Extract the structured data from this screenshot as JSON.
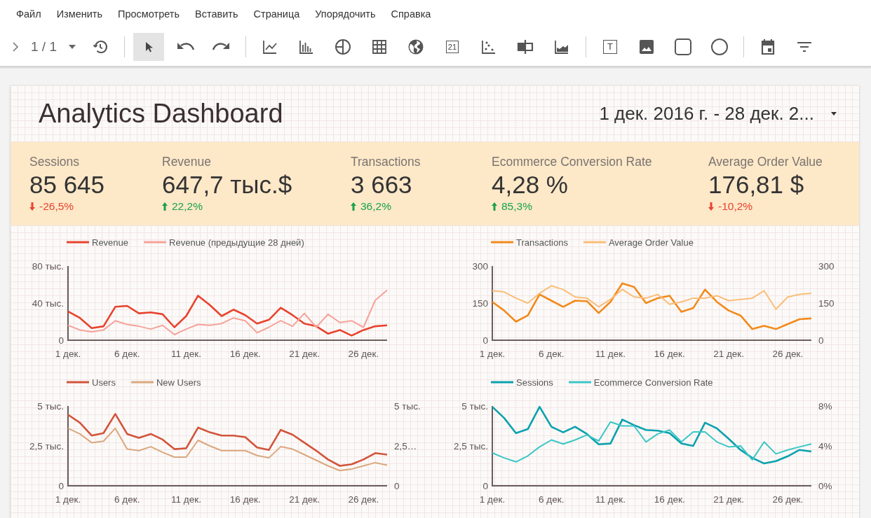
{
  "menu": [
    "Файл",
    "Изменить",
    "Просмотреть",
    "Вставить",
    "Страница",
    "Упорядочить",
    "Справка"
  ],
  "toolbar": {
    "groups": [
      [
        {
          "kind": "next-page",
          "selected": false
        },
        {
          "kind": "page",
          "label": "1 / 1",
          "selected": false
        },
        {
          "kind": "dropdown",
          "selected": false
        },
        {
          "kind": "history",
          "selected": false
        }
      ],
      [
        {
          "kind": "pointer",
          "selected": true
        },
        {
          "kind": "undo",
          "selected": false
        },
        {
          "kind": "redo",
          "selected": false
        }
      ],
      [
        {
          "kind": "line-chart",
          "selected": false
        },
        {
          "kind": "bar-chart",
          "selected": false
        },
        {
          "kind": "pie-chart",
          "selected": false
        },
        {
          "kind": "table",
          "selected": false
        },
        {
          "kind": "geo-map",
          "selected": false
        },
        {
          "kind": "scorecard",
          "label": "21",
          "selected": false
        },
        {
          "kind": "scatter",
          "selected": false
        },
        {
          "kind": "bullet",
          "selected": false
        },
        {
          "kind": "area-chart",
          "selected": false
        }
      ],
      [
        {
          "kind": "text",
          "label": "T",
          "selected": false
        },
        {
          "kind": "image",
          "selected": false
        },
        {
          "kind": "rectangle",
          "selected": false
        },
        {
          "kind": "circle",
          "selected": false
        }
      ],
      [
        {
          "kind": "calendar",
          "selected": false
        },
        {
          "kind": "filter",
          "selected": false
        }
      ]
    ]
  },
  "report": {
    "title": "Analytics Dashboard",
    "date_range": "1 дек. 2016 г. - 28 дек. 2...",
    "scorecards": [
      {
        "label": "Sessions",
        "value": "85 645",
        "delta": "-26,5%",
        "increase": false
      },
      {
        "label": "Revenue",
        "value": "647,7 тыс.$",
        "delta": "22,2%",
        "increase": true
      },
      {
        "label": "Transactions",
        "value": "3 663",
        "delta": "36,2%",
        "increase": true
      },
      {
        "label": "Ecommerce Conversion Rate",
        "value": "4,28 %",
        "delta": "85,3%",
        "increase": true
      },
      {
        "label": "Average Order Value",
        "value": "176,81 $",
        "delta": "-10,2%",
        "increase": false
      }
    ],
    "charts": [
      {
        "chart_data": {
          "type": "line",
          "x": [
            1,
            2,
            3,
            4,
            5,
            6,
            7,
            8,
            9,
            10,
            11,
            12,
            13,
            14,
            15,
            16,
            17,
            18,
            19,
            20,
            21,
            22,
            23,
            24,
            25,
            26,
            27,
            28
          ],
          "legend": true,
          "xlim": [
            1,
            28
          ],
          "ylim": [
            0,
            80
          ],
          "yticks": [
            {
              "value": 0,
              "label": "0"
            },
            {
              "value": 40,
              "label": "40 тыс."
            },
            {
              "value": 80,
              "label": "80 тыс."
            }
          ],
          "xticks": [
            {
              "value": 1,
              "label": "1 дек."
            },
            {
              "value": 6,
              "label": "6 дек."
            },
            {
              "value": 11,
              "label": "11 дек."
            },
            {
              "value": 16,
              "label": "16 дек."
            },
            {
              "value": 21,
              "label": "21 дек."
            },
            {
              "value": 26,
              "label": "26 дек."
            }
          ],
          "series": [
            {
              "name": "Revenue",
              "color": "#e8432e",
              "values": [
                31,
                24,
                13,
                15,
                36,
                37,
                29,
                30,
                28,
                14,
                26,
                48,
                38,
                26,
                33,
                27,
                18,
                22,
                35,
                27,
                18,
                15,
                7,
                11,
                5,
                11,
                15,
                16
              ]
            },
            {
              "name": "Revenue (предыдущие 28 дней)",
              "color": "#f6a29a",
              "values": [
                16,
                11,
                9,
                11,
                21,
                17,
                15,
                12,
                16,
                6,
                12,
                17,
                16,
                18,
                24,
                21,
                8,
                14,
                21,
                15,
                29,
                14,
                28,
                19,
                21,
                14,
                43,
                54
              ]
            }
          ]
        }
      },
      {
        "chart_data": {
          "type": "line",
          "x": [
            1,
            2,
            3,
            4,
            5,
            6,
            7,
            8,
            9,
            10,
            11,
            12,
            13,
            14,
            15,
            16,
            17,
            18,
            19,
            20,
            21,
            22,
            23,
            24,
            25,
            26,
            27,
            28
          ],
          "legend": true,
          "xlim": [
            1,
            28
          ],
          "ylim": [
            0,
            300
          ],
          "yticks": [
            0,
            150,
            300
          ],
          "y2lim": [
            0,
            300
          ],
          "y2ticks": [
            0,
            150,
            300
          ],
          "xticks": [
            {
              "value": 1,
              "label": "1 дек."
            },
            {
              "value": 6,
              "label": "6 дек."
            },
            {
              "value": 11,
              "label": "11 дек."
            },
            {
              "value": 16,
              "label": "16 дек."
            },
            {
              "value": 21,
              "label": "21 дек."
            },
            {
              "value": 26,
              "label": "26 дек."
            }
          ],
          "series": [
            {
              "name": "Transactions",
              "color": "#f28a1c",
              "values": [
                155,
                120,
                75,
                100,
                185,
                160,
                135,
                160,
                158,
                110,
                155,
                230,
                215,
                150,
                170,
                180,
                115,
                130,
                205,
                155,
                120,
                100,
                45,
                58,
                45,
                65,
                85,
                88
              ]
            },
            {
              "name": "Average Order Value",
              "color": "#fbbd78",
              "axis": "y2",
              "values": [
                200,
                195,
                170,
                150,
                190,
                220,
                205,
                175,
                170,
                135,
                165,
                205,
                175,
                170,
                185,
                145,
                155,
                170,
                170,
                180,
                160,
                165,
                170,
                200,
                125,
                175,
                185,
                190
              ]
            }
          ]
        }
      },
      {
        "chart_data": {
          "type": "line",
          "x": [
            1,
            2,
            3,
            4,
            5,
            6,
            7,
            8,
            9,
            10,
            11,
            12,
            13,
            14,
            15,
            16,
            17,
            18,
            19,
            20,
            21,
            22,
            23,
            24,
            25,
            26,
            27,
            28
          ],
          "legend": true,
          "xlim": [
            1,
            28
          ],
          "ylim": [
            0,
            5
          ],
          "yticks": [
            {
              "value": 0,
              "label": "0"
            },
            {
              "value": 2.5,
              "label": "2,5 тыс."
            },
            {
              "value": 5,
              "label": "5 тыс."
            }
          ],
          "y2lim": [
            0,
            5
          ],
          "y2ticks": [
            {
              "value": 0,
              "label": "0"
            },
            {
              "value": 2.5,
              "label": "2,5…"
            },
            {
              "value": 5,
              "label": "5 тыс."
            }
          ],
          "xticks": [
            {
              "value": 1,
              "label": "1 дек."
            },
            {
              "value": 6,
              "label": "6 дек."
            },
            {
              "value": 11,
              "label": "11 дек."
            },
            {
              "value": 16,
              "label": "16 дек."
            },
            {
              "value": 21,
              "label": "21 дек."
            },
            {
              "value": 26,
              "label": "26 дек."
            }
          ],
          "series": [
            {
              "name": "Users",
              "color": "#d2543a",
              "values": [
                4.45,
                3.95,
                3.15,
                3.3,
                4.5,
                3.25,
                3.0,
                3.25,
                2.9,
                2.3,
                2.35,
                3.65,
                3.35,
                3.15,
                3.15,
                3.05,
                2.4,
                2.25,
                3.5,
                3.2,
                2.7,
                2.2,
                1.65,
                1.25,
                1.35,
                1.65,
                2.05,
                1.95
              ]
            },
            {
              "name": "New Users",
              "color": "#dba77e",
              "axis": "y2",
              "values": [
                3.6,
                3.25,
                2.7,
                2.8,
                3.6,
                2.3,
                2.2,
                2.45,
                2.1,
                1.8,
                1.8,
                2.85,
                2.5,
                2.2,
                2.2,
                2.2,
                1.9,
                1.75,
                2.45,
                2.3,
                1.95,
                1.6,
                1.25,
                0.95,
                1.05,
                1.25,
                1.45,
                1.3
              ]
            }
          ]
        }
      },
      {
        "chart_data": {
          "type": "line",
          "x": [
            1,
            2,
            3,
            4,
            5,
            6,
            7,
            8,
            9,
            10,
            11,
            12,
            13,
            14,
            15,
            16,
            17,
            18,
            19,
            20,
            21,
            22,
            23,
            24,
            25,
            26,
            27,
            28
          ],
          "legend": true,
          "xlim": [
            1,
            28
          ],
          "ylim": [
            0,
            5
          ],
          "yticks": [
            {
              "value": 0,
              "label": "0"
            },
            {
              "value": 2.5,
              "label": "2,5 тыс."
            },
            {
              "value": 5,
              "label": "5 тыс."
            }
          ],
          "y2lim": [
            0,
            8
          ],
          "y2ticks": [
            {
              "value": 0,
              "label": "0%"
            },
            {
              "value": 4,
              "label": "4%"
            },
            {
              "value": 8,
              "label": "8%"
            }
          ],
          "xticks": [
            {
              "value": 1,
              "label": "1 дек."
            },
            {
              "value": 6,
              "label": "6 дек."
            },
            {
              "value": 11,
              "label": "11 дек."
            },
            {
              "value": 16,
              "label": "16 дек."
            },
            {
              "value": 21,
              "label": "21 дек."
            },
            {
              "value": 26,
              "label": "26 дек."
            }
          ],
          "series": [
            {
              "name": "Sessions",
              "color": "#0aa2ae",
              "values": [
                4.95,
                4.25,
                3.3,
                3.55,
                4.95,
                3.7,
                3.35,
                3.7,
                3.25,
                2.6,
                2.65,
                4.15,
                3.8,
                3.5,
                3.45,
                3.3,
                2.65,
                2.5,
                3.95,
                3.6,
                2.95,
                2.25,
                1.75,
                1.4,
                1.55,
                1.85,
                2.25,
                2.15
              ]
            },
            {
              "name": "Ecommerce Conversion Rate",
              "color": "#3cc6c6",
              "axis": "y2",
              "values": [
                3.3,
                2.8,
                2.4,
                3.0,
                3.9,
                4.6,
                4.2,
                4.6,
                5.1,
                4.5,
                6.4,
                6.0,
                6.0,
                4.4,
                5.2,
                5.6,
                4.4,
                5.4,
                5.4,
                4.4,
                3.9,
                4.0,
                2.6,
                4.4,
                3.2,
                3.6,
                3.9,
                4.2
              ]
            }
          ]
        }
      }
    ]
  }
}
